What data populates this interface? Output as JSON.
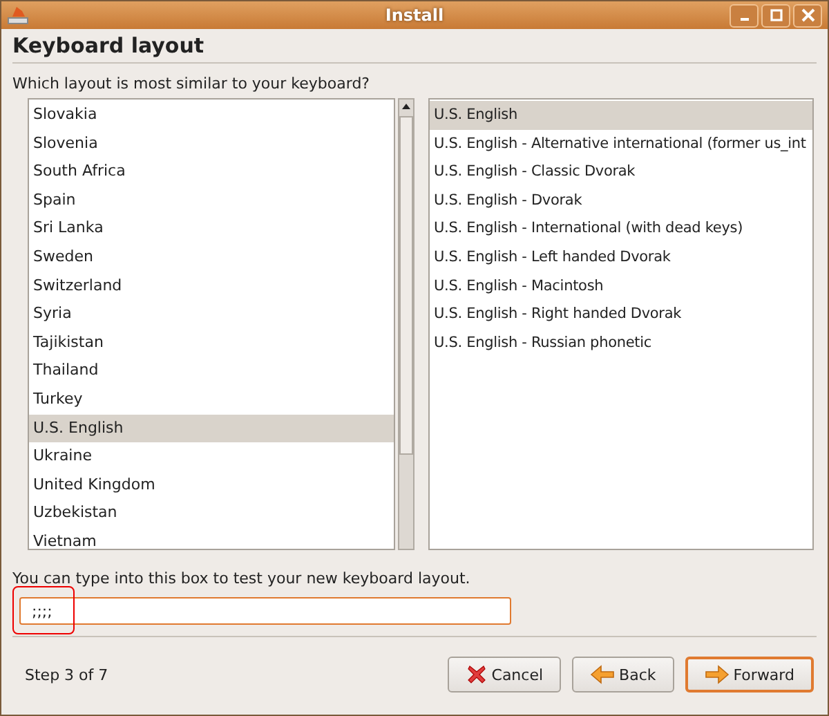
{
  "window": {
    "title": "Install"
  },
  "heading": "Keyboard layout",
  "question": "Which layout is most similar to your keyboard?",
  "countries": [
    {
      "label": "Slovakia",
      "selected": false
    },
    {
      "label": "Slovenia",
      "selected": false
    },
    {
      "label": "South Africa",
      "selected": false
    },
    {
      "label": "Spain",
      "selected": false
    },
    {
      "label": "Sri Lanka",
      "selected": false
    },
    {
      "label": "Sweden",
      "selected": false
    },
    {
      "label": "Switzerland",
      "selected": false
    },
    {
      "label": "Syria",
      "selected": false
    },
    {
      "label": "Tajikistan",
      "selected": false
    },
    {
      "label": "Thailand",
      "selected": false
    },
    {
      "label": "Turkey",
      "selected": false
    },
    {
      "label": "U.S. English",
      "selected": true
    },
    {
      "label": "Ukraine",
      "selected": false
    },
    {
      "label": "United Kingdom",
      "selected": false
    },
    {
      "label": "Uzbekistan",
      "selected": false
    },
    {
      "label": "Vietnam",
      "selected": false
    }
  ],
  "variants": [
    {
      "label": "U.S. English",
      "selected": true
    },
    {
      "label": "U.S. English - Alternative international (former us_int",
      "selected": false
    },
    {
      "label": "U.S. English - Classic Dvorak",
      "selected": false
    },
    {
      "label": "U.S. English - Dvorak",
      "selected": false
    },
    {
      "label": "U.S. English - International (with dead keys)",
      "selected": false
    },
    {
      "label": "U.S. English - Left handed Dvorak",
      "selected": false
    },
    {
      "label": "U.S. English - Macintosh",
      "selected": false
    },
    {
      "label": "U.S. English - Right handed Dvorak",
      "selected": false
    },
    {
      "label": "U.S. English - Russian phonetic",
      "selected": false
    }
  ],
  "test_label": "You can type into this box to test your new keyboard layout.",
  "test_field": {
    "value": ";;;;"
  },
  "step": "Step 3 of 7",
  "buttons": [
    {
      "kind": "cancel",
      "label": "Cancel",
      "default": false
    },
    {
      "kind": "back",
      "label": "Back",
      "default": false
    },
    {
      "kind": "forward",
      "label": "Forward",
      "default": true
    }
  ]
}
